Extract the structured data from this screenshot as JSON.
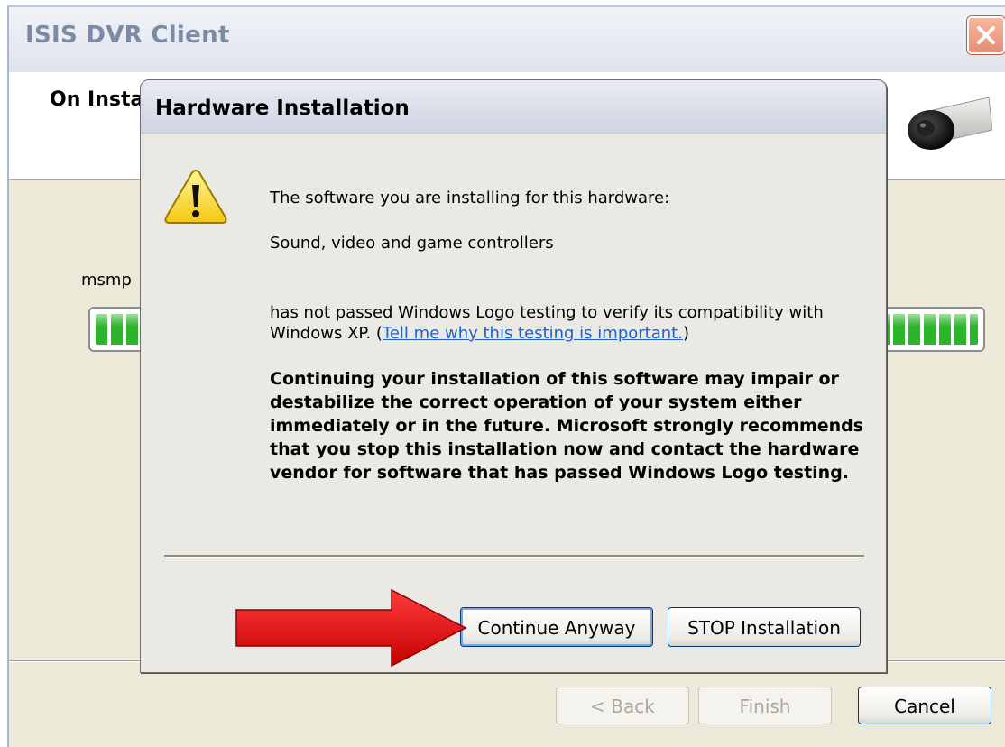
{
  "window": {
    "title": "ISIS DVR Client",
    "close_icon": "close-icon",
    "header_heading": "On Insta",
    "current_file": "msmp",
    "progress_percent": 100,
    "buttons": {
      "back": "< Back",
      "finish": "Finish",
      "cancel": "Cancel"
    }
  },
  "dialog": {
    "title": "Hardware Installation",
    "icon": "warning-icon",
    "line1": "The software you are installing for this hardware:",
    "device": "Sound, video and game controllers",
    "line3_a": "has not passed Windows Logo testing to verify its compatibility with Windows XP. (",
    "line3_link": "Tell me why this testing is important.",
    "line3_b": ")",
    "warning": "Continuing your installation of this software may impair or destabilize the correct operation of your system either immediately or in the future. Microsoft strongly recommends that you stop this installation now and contact the hardware vendor for software that has passed Windows Logo testing.",
    "buttons": {
      "continue": "Continue Anyway",
      "stop": "STOP Installation"
    }
  },
  "annotation": {
    "icon": "red-arrow-icon",
    "color": "#e11111"
  }
}
